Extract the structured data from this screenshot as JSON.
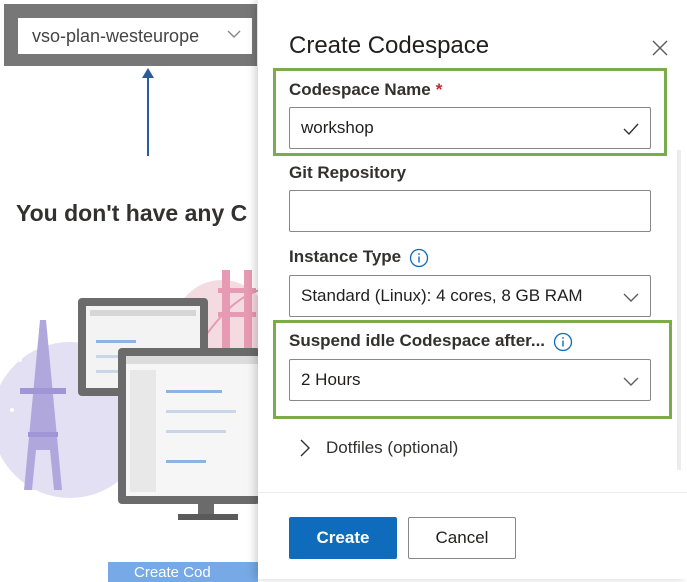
{
  "background": {
    "plan_select_value": "vso-plan-westeurope",
    "empty_heading": "You don't have any C",
    "create_button_partial": "Create Cod"
  },
  "panel": {
    "title": "Create Codespace",
    "fields": {
      "name": {
        "label": "Codespace Name",
        "required_marker": "*",
        "value": "workshop"
      },
      "repo": {
        "label": "Git Repository",
        "value": ""
      },
      "instance": {
        "label": "Instance Type",
        "value": "Standard (Linux): 4 cores, 8 GB RAM"
      },
      "suspend": {
        "label": "Suspend idle Codespace after...",
        "value": "2 Hours"
      }
    },
    "dotfiles_label": "Dotfiles (optional)",
    "create_label": "Create",
    "cancel_label": "Cancel"
  },
  "colors": {
    "primary": "#0f6cbd",
    "highlight": "#7aab4c",
    "required": "#c4262e",
    "arrow": "#2d5a9a"
  },
  "icons": [
    "chevron-down-icon",
    "arrow-up-icon",
    "close-icon",
    "checkmark-icon",
    "info-icon",
    "chevron-right-icon"
  ]
}
